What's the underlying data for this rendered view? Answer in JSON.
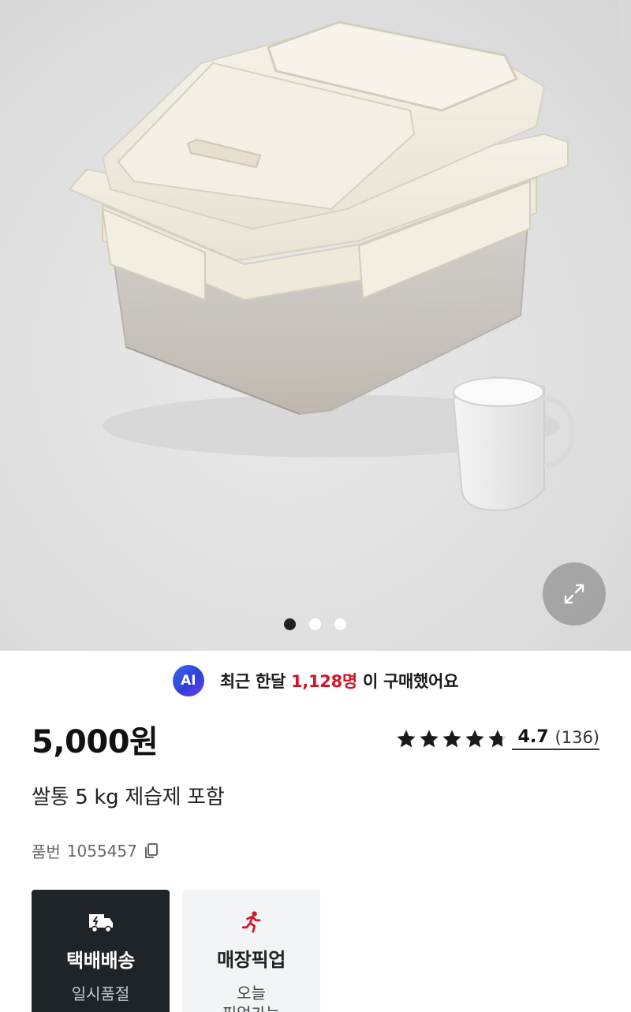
{
  "ai_banner": {
    "badge": "AI",
    "text_before": "최근 한달 ",
    "highlight": "1,128명",
    "text_after": " 이 구매했어요"
  },
  "product": {
    "price": "5,000원",
    "title": "쌀통 5 kg 제습제 포함",
    "sku_label": "품번",
    "sku_value": "1055457"
  },
  "rating": {
    "value": "4.7",
    "count": "(136)",
    "stars": 4.7
  },
  "gallery": {
    "page_count": 3,
    "active_index": 0
  },
  "delivery": {
    "options": [
      {
        "title": "택배배송",
        "sub": "일시품절",
        "icon": "delivery-truck-icon"
      },
      {
        "title": "매장픽업",
        "sub": "오늘\n픽업가능",
        "icon": "running-person-icon"
      }
    ]
  },
  "colors": {
    "highlight": "#d0162a",
    "dark_card": "#1f2428",
    "light_card": "#f3f4f5"
  }
}
